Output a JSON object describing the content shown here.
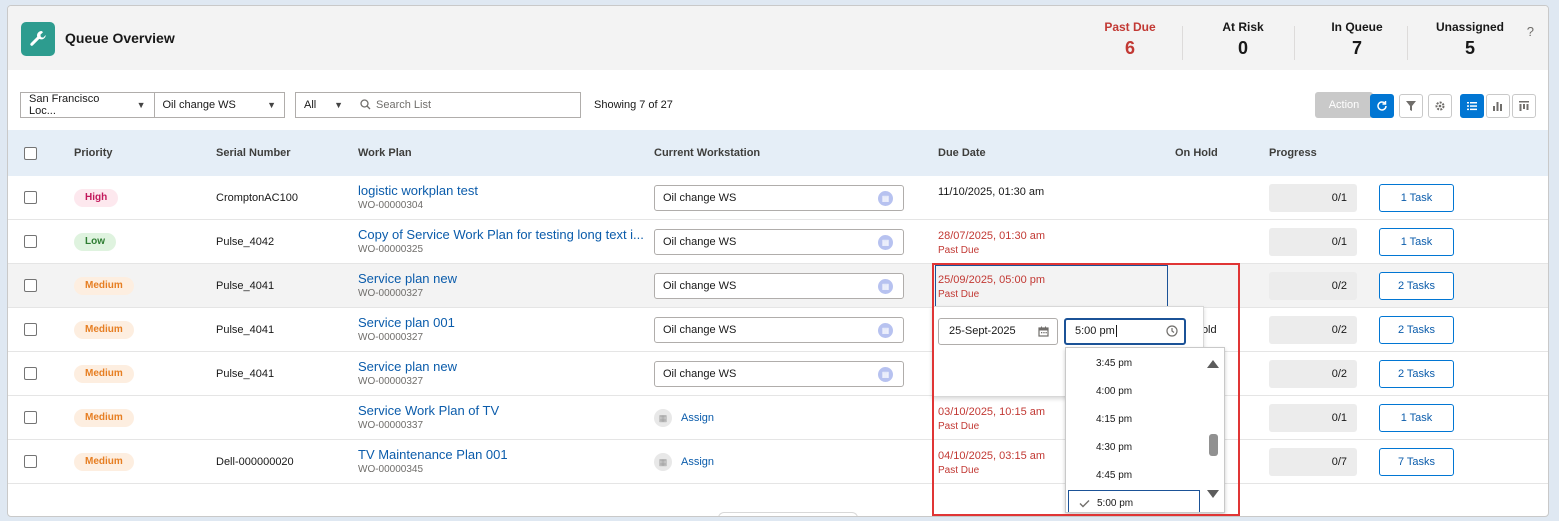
{
  "header": {
    "title": "Queue Overview",
    "help": "?",
    "kpis": [
      {
        "label": "Past Due",
        "value": "6"
      },
      {
        "label": "At Risk",
        "value": "0"
      },
      {
        "label": "In Queue",
        "value": "7"
      },
      {
        "label": "Unassigned",
        "value": "5"
      }
    ]
  },
  "toolbar": {
    "location": "San Francisco Loc...",
    "workstation": "Oil change WS",
    "scope": "All",
    "search_placeholder": "Search List",
    "showing": "Showing 7 of 27",
    "action_label": "Action"
  },
  "table": {
    "columns": [
      "Priority",
      "Serial Number",
      "Work Plan",
      "Current Workstation",
      "Due Date",
      "On Hold",
      "Progress"
    ],
    "rows": [
      {
        "priority": "High",
        "serial": "CromptonAC100",
        "plan": "logistic workplan test",
        "plan_id": "WO-00000304",
        "workstation": "Oil change WS",
        "due": "11/10/2025, 01:30 am",
        "due_status": "",
        "on_hold": "",
        "progress": "0/1",
        "tasks": "1 Task"
      },
      {
        "priority": "Low",
        "serial": "Pulse_4042",
        "plan": "Copy of Service Work Plan for testing long text i...",
        "plan_id": "WO-00000325",
        "workstation": "Oil change WS",
        "due": "28/07/2025, 01:30 am",
        "due_status": "Past Due",
        "on_hold": "",
        "progress": "0/1",
        "tasks": "1 Task"
      },
      {
        "priority": "Medium",
        "serial": "Pulse_4041",
        "plan": "Service plan new",
        "plan_id": "WO-00000327",
        "workstation": "Oil change WS",
        "due": "25/09/2025, 05:00 pm",
        "due_status": "Past Due",
        "on_hold": "",
        "progress": "0/2",
        "tasks": "2 Tasks"
      },
      {
        "priority": "Medium",
        "serial": "Pulse_4041",
        "plan": "Service plan 001",
        "plan_id": "WO-00000327",
        "workstation": "Oil change WS",
        "due": "",
        "due_status": "",
        "on_hold": "Hold",
        "progress": "0/2",
        "tasks": "2 Tasks"
      },
      {
        "priority": "Medium",
        "serial": "Pulse_4041",
        "plan": "Service plan new",
        "plan_id": "WO-00000327",
        "workstation": "Oil change WS",
        "due": "",
        "due_status": "",
        "on_hold": "",
        "progress": "0/2",
        "tasks": "2 Tasks"
      },
      {
        "priority": "Medium",
        "serial": "",
        "plan": "Service Work Plan of TV",
        "plan_id": "WO-00000337",
        "workstation": "",
        "assign": "Assign",
        "due": "03/10/2025, 10:15 am",
        "due_status": "Past Due",
        "on_hold": "",
        "progress": "0/1",
        "tasks": "1 Task"
      },
      {
        "priority": "Medium",
        "serial": "Dell-000000020",
        "plan": "TV Maintenance Plan 001",
        "plan_id": "WO-00000345",
        "workstation": "",
        "assign": "Assign",
        "due": "04/10/2025, 03:15 am",
        "due_status": "Past Due",
        "on_hold": "",
        "progress": "0/7",
        "tasks": "7 Tasks"
      }
    ]
  },
  "editor": {
    "date_value": "25-Sept-2025",
    "time_value": "5:00 pm",
    "time_options": [
      "3:45 pm",
      "4:00 pm",
      "4:15 pm",
      "4:30 pm",
      "4:45 pm",
      "5:00 pm"
    ],
    "selected_index": 5
  },
  "colors": {
    "brand": "#0176d3",
    "past_due": "#c23934",
    "highlight_outline": "#e03535",
    "app_icon": "#2d9c8f"
  }
}
